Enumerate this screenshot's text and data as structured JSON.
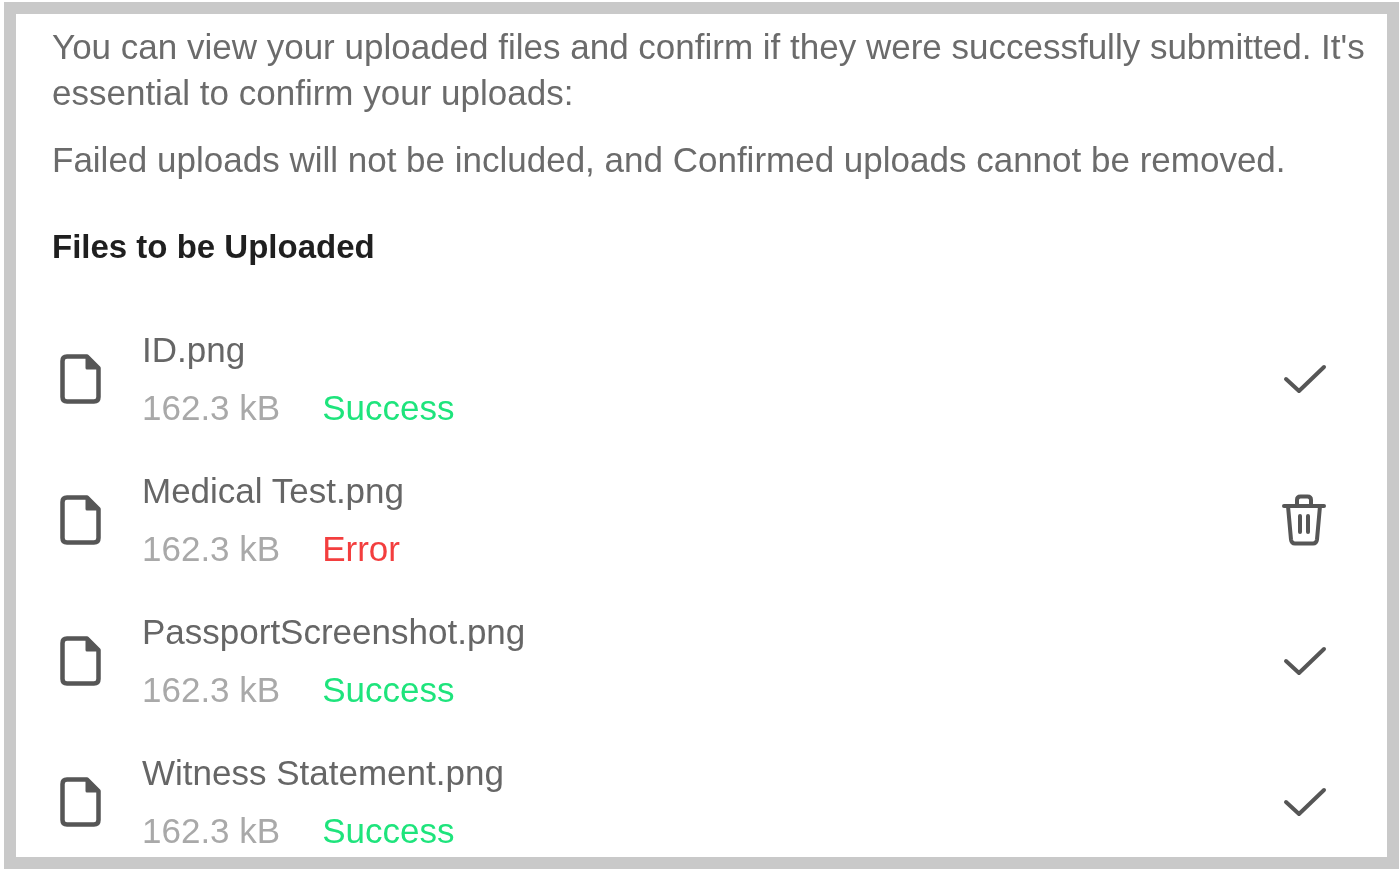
{
  "intro": {
    "paragraphs": [
      "You can view your uploaded files and confirm if they were successfully submitted. It's essential to confirm your uploads:",
      "Failed uploads will not be included, and Confirmed uploads cannot be removed."
    ]
  },
  "files_section": {
    "title": "Files to be Uploaded",
    "files": [
      {
        "name": "ID.png",
        "size": "162.3 kB",
        "status": "Success",
        "kind": "success"
      },
      {
        "name": "Medical Test.png",
        "size": "162.3 kB",
        "status": "Error",
        "kind": "error"
      },
      {
        "name": "PassportScreenshot.png",
        "size": "162.3 kB",
        "status": "Success",
        "kind": "success"
      },
      {
        "name": "Witness Statement.png",
        "size": "162.3 kB",
        "status": "Success",
        "kind": "success"
      }
    ]
  }
}
